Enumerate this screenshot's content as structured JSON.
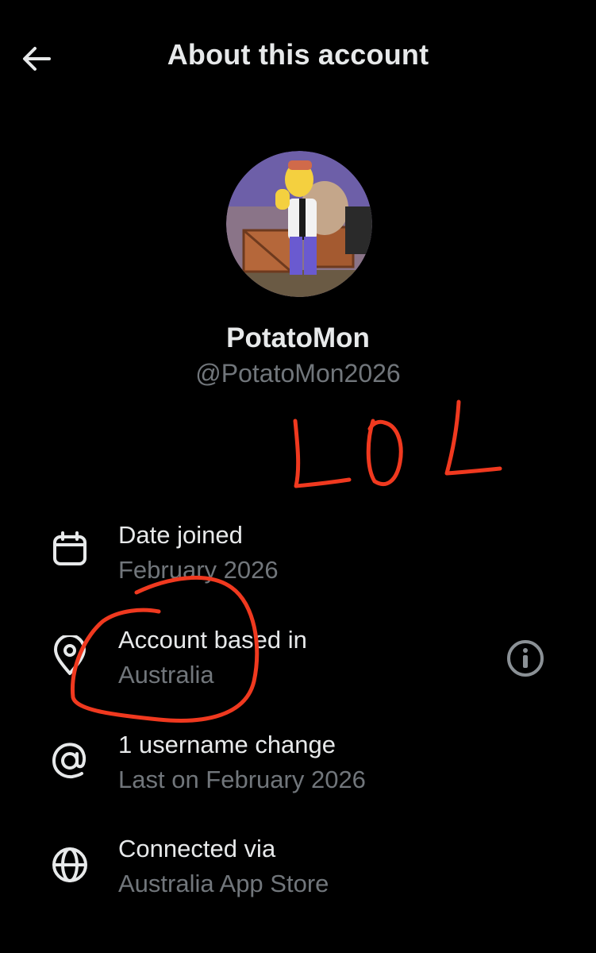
{
  "header": {
    "title": "About this account",
    "back_icon": "arrow-left-icon"
  },
  "profile": {
    "display_name": "PotatoMon",
    "handle": "@PotatoMon2026",
    "avatar_icon": "cartoon-character-avatar"
  },
  "annotation": {
    "text": "LOL",
    "color": "#f0391f"
  },
  "rows": [
    {
      "icon": "calendar-icon",
      "title": "Date joined",
      "subtitle": "February 2026"
    },
    {
      "icon": "location-pin-icon",
      "title": "Account based in",
      "subtitle": "Australia",
      "trailing_icon": "info-icon"
    },
    {
      "icon": "at-sign-icon",
      "title": "1 username change",
      "subtitle": "Last on February 2026"
    },
    {
      "icon": "globe-icon",
      "title": "Connected via",
      "subtitle": "Australia App Store"
    }
  ],
  "colors": {
    "background": "#000000",
    "primary_text": "#e7e9ea",
    "secondary_text": "#71767b",
    "annotation_red": "#f0391f"
  }
}
